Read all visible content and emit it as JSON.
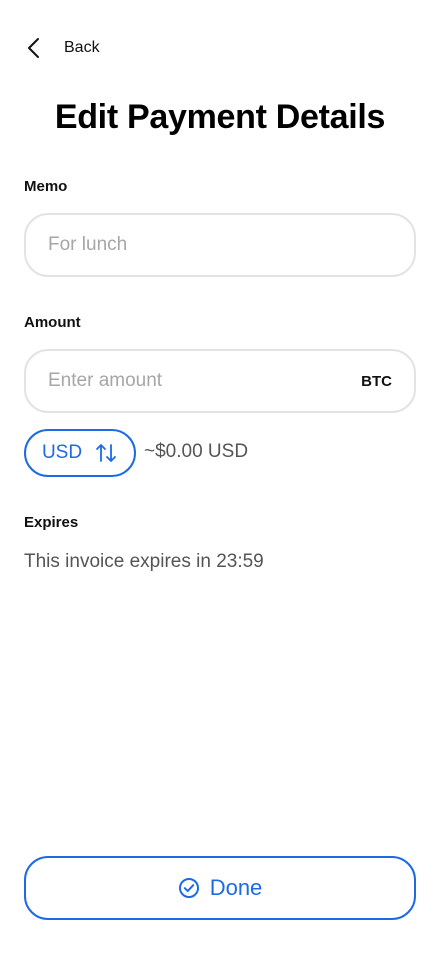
{
  "nav": {
    "back_label": "Back"
  },
  "page": {
    "title": "Edit Payment Details"
  },
  "memo": {
    "label": "Memo",
    "placeholder": "For lunch",
    "value": ""
  },
  "amount": {
    "label": "Amount",
    "placeholder": "Enter amount",
    "value": "",
    "unit": "BTC",
    "toggle_currency": "USD",
    "converted_value": "~$0.00 USD"
  },
  "expires": {
    "label": "Expires",
    "text": "This invoice expires in 23:59"
  },
  "actions": {
    "done_label": "Done"
  },
  "colors": {
    "accent": "#1d6ae5",
    "border": "#e3e3e3",
    "muted_text": "#555555",
    "placeholder": "#a6a6a6"
  },
  "icons": {
    "back": "chevron-left-icon",
    "swap": "swap-arrows-icon",
    "done": "check-circle-icon"
  }
}
